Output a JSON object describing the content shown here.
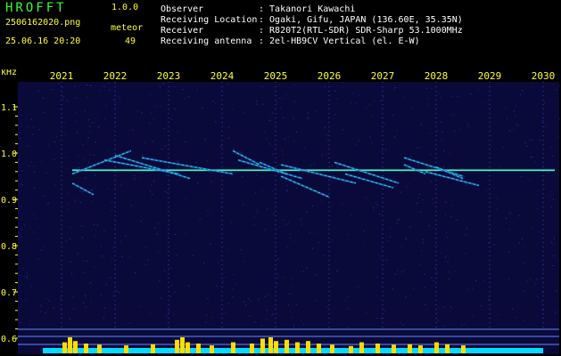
{
  "header": {
    "app_title": "HROFFT",
    "app_version": "1.0.0",
    "file_name": "2506162020.png",
    "timestamp": "25.06.16 20:20",
    "meteor_label": "meteor",
    "meteor_count": "49"
  },
  "info": [
    {
      "label": "Observer",
      "value": ": Takanori Kawachi"
    },
    {
      "label": "Receiving Location",
      "value": ": Ogaki, Gifu, JAPAN (136.60E, 35.35N)"
    },
    {
      "label": "Receiver",
      "value": ": R820T2(RTL-SDR) SDR-Sharp 53.1000MHz"
    },
    {
      "label": "Receiving antenna",
      "value": ": 2el-HB9CV Vertical (el. E-W)"
    }
  ],
  "chart_data": {
    "type": "heatmap",
    "ylabel": "kHz",
    "x_ticks": [
      "2021",
      "2022",
      "2023",
      "2024",
      "2025",
      "2026",
      "2027",
      "2028",
      "2029",
      "2030"
    ],
    "y_ticks": [
      "1.1",
      "1.0",
      "0.9",
      "0.8",
      "0.7",
      "0.6"
    ],
    "ylim": [
      0.58,
      1.18
    ],
    "carrier_khz": 0.963,
    "colors": {
      "background": "#0a0a3a",
      "grid": "#3344bb",
      "axis_text": "#ffff33",
      "signal": "#33ff66",
      "level": "#ffdd00",
      "level_base": "#00ddff",
      "ref_line": "#6688ff"
    },
    "traces": [
      {
        "x": [
          2021.2,
          2022.3
        ],
        "y": [
          0.955,
          1.005
        ]
      },
      {
        "x": [
          2021.8,
          2023.2
        ],
        "y": [
          0.985,
          0.955
        ]
      },
      {
        "x": [
          2022.0,
          2023.4
        ],
        "y": [
          0.995,
          0.945
        ]
      },
      {
        "x": [
          2021.2,
          2021.6
        ],
        "y": [
          0.935,
          0.91
        ]
      },
      {
        "x": [
          2022.5,
          2024.2
        ],
        "y": [
          0.99,
          0.955
        ]
      },
      {
        "x": [
          2024.2,
          2024.7
        ],
        "y": [
          1.005,
          0.975
        ]
      },
      {
        "x": [
          2024.7,
          2025.2
        ],
        "y": [
          0.98,
          0.955
        ]
      },
      {
        "x": [
          2024.3,
          2025.5
        ],
        "y": [
          0.985,
          0.945
        ]
      },
      {
        "x": [
          2025.1,
          2026.0
        ],
        "y": [
          0.95,
          0.905
        ]
      },
      {
        "x": [
          2025.1,
          2026.5
        ],
        "y": [
          0.975,
          0.935
        ]
      },
      {
        "x": [
          2026.1,
          2027.3
        ],
        "y": [
          0.98,
          0.935
        ]
      },
      {
        "x": [
          2026.3,
          2027.2
        ],
        "y": [
          0.955,
          0.925
        ]
      },
      {
        "x": [
          2027.4,
          2027.8
        ],
        "y": [
          0.975,
          0.955
        ]
      },
      {
        "x": [
          2027.4,
          2028.5
        ],
        "y": [
          0.99,
          0.95
        ]
      },
      {
        "x": [
          2027.8,
          2028.8
        ],
        "y": [
          0.96,
          0.93
        ]
      },
      {
        "x": [
          2028.0,
          2028.5
        ],
        "y": [
          0.97,
          0.945
        ]
      }
    ],
    "level_bars": [
      {
        "x": 2021.05,
        "h": 0.6
      },
      {
        "x": 2021.15,
        "h": 1.0
      },
      {
        "x": 2021.25,
        "h": 0.7
      },
      {
        "x": 2021.45,
        "h": 0.5
      },
      {
        "x": 2021.7,
        "h": 0.4
      },
      {
        "x": 2022.2,
        "h": 0.35
      },
      {
        "x": 2022.7,
        "h": 0.45
      },
      {
        "x": 2023.15,
        "h": 0.8
      },
      {
        "x": 2023.25,
        "h": 1.0
      },
      {
        "x": 2023.35,
        "h": 0.6
      },
      {
        "x": 2023.55,
        "h": 0.5
      },
      {
        "x": 2023.8,
        "h": 0.35
      },
      {
        "x": 2024.2,
        "h": 0.6
      },
      {
        "x": 2024.55,
        "h": 0.5
      },
      {
        "x": 2024.75,
        "h": 0.9
      },
      {
        "x": 2024.9,
        "h": 1.0
      },
      {
        "x": 2025.0,
        "h": 0.7
      },
      {
        "x": 2025.2,
        "h": 0.8
      },
      {
        "x": 2025.4,
        "h": 0.6
      },
      {
        "x": 2025.6,
        "h": 0.7
      },
      {
        "x": 2025.8,
        "h": 0.5
      },
      {
        "x": 2026.05,
        "h": 0.4
      },
      {
        "x": 2026.4,
        "h": 0.3
      },
      {
        "x": 2026.6,
        "h": 0.6
      },
      {
        "x": 2026.9,
        "h": 0.5
      },
      {
        "x": 2027.2,
        "h": 0.4
      },
      {
        "x": 2027.5,
        "h": 0.45
      },
      {
        "x": 2027.7,
        "h": 0.35
      },
      {
        "x": 2028.0,
        "h": 0.6
      },
      {
        "x": 2028.2,
        "h": 0.45
      },
      {
        "x": 2028.5,
        "h": 0.35
      }
    ],
    "level_range": [
      2020.65,
      2030.0
    ]
  }
}
